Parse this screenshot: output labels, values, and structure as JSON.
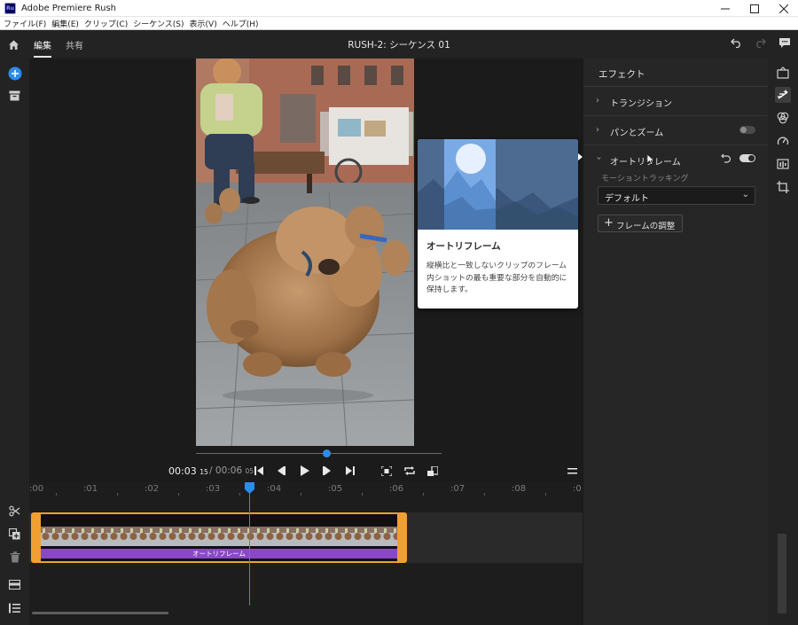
{
  "window": {
    "app_logo": "Ru",
    "title": "Adobe Premiere Rush",
    "controls": [
      "minimize-icon",
      "maximize-icon",
      "close-icon"
    ]
  },
  "menu": [
    "ファイル(F)",
    "編集(E)",
    "クリップ(C)",
    "シーケンス(S)",
    "表示(V)",
    "ヘルプ(H)"
  ],
  "header": {
    "tabs": [
      {
        "label": "編集",
        "active": true
      },
      {
        "label": "共有",
        "active": false
      }
    ],
    "sequence_title": "RUSH-2: シーケンス 01"
  },
  "transport": {
    "current_time": "00:03",
    "current_frames": "15",
    "duration_time": "00:06",
    "duration_frames": "05",
    "playhead_progress": 0.58
  },
  "tooltip": {
    "title": "オートリフレーム",
    "description": "縦横比と一致しないクリップのフレーム内ショットの最も重要な部分を自動的に保持します。"
  },
  "timeline": {
    "ruler": [
      ":00",
      ":01",
      ":02",
      ":03",
      ":04",
      ":05",
      ":06",
      ":07",
      ":08",
      ":0"
    ],
    "clip_effect_label": "オートリフレーム"
  },
  "panel": {
    "title": "エフェクト",
    "sections": [
      {
        "label": "トランジション",
        "expanded": false
      },
      {
        "label": "パンとズーム",
        "expanded": false,
        "toggle": false
      },
      {
        "label": "オートリフレーム",
        "expanded": true,
        "toggle": true
      }
    ],
    "motion_tracking_label": "モーショントラッキング",
    "motion_tracking_value": "デフォルト",
    "adjust_button": "フレームの調整"
  },
  "colors": {
    "accent": "#2d8ceb",
    "clip_border": "#f0a030",
    "effect_bar": "#8a48c8"
  }
}
